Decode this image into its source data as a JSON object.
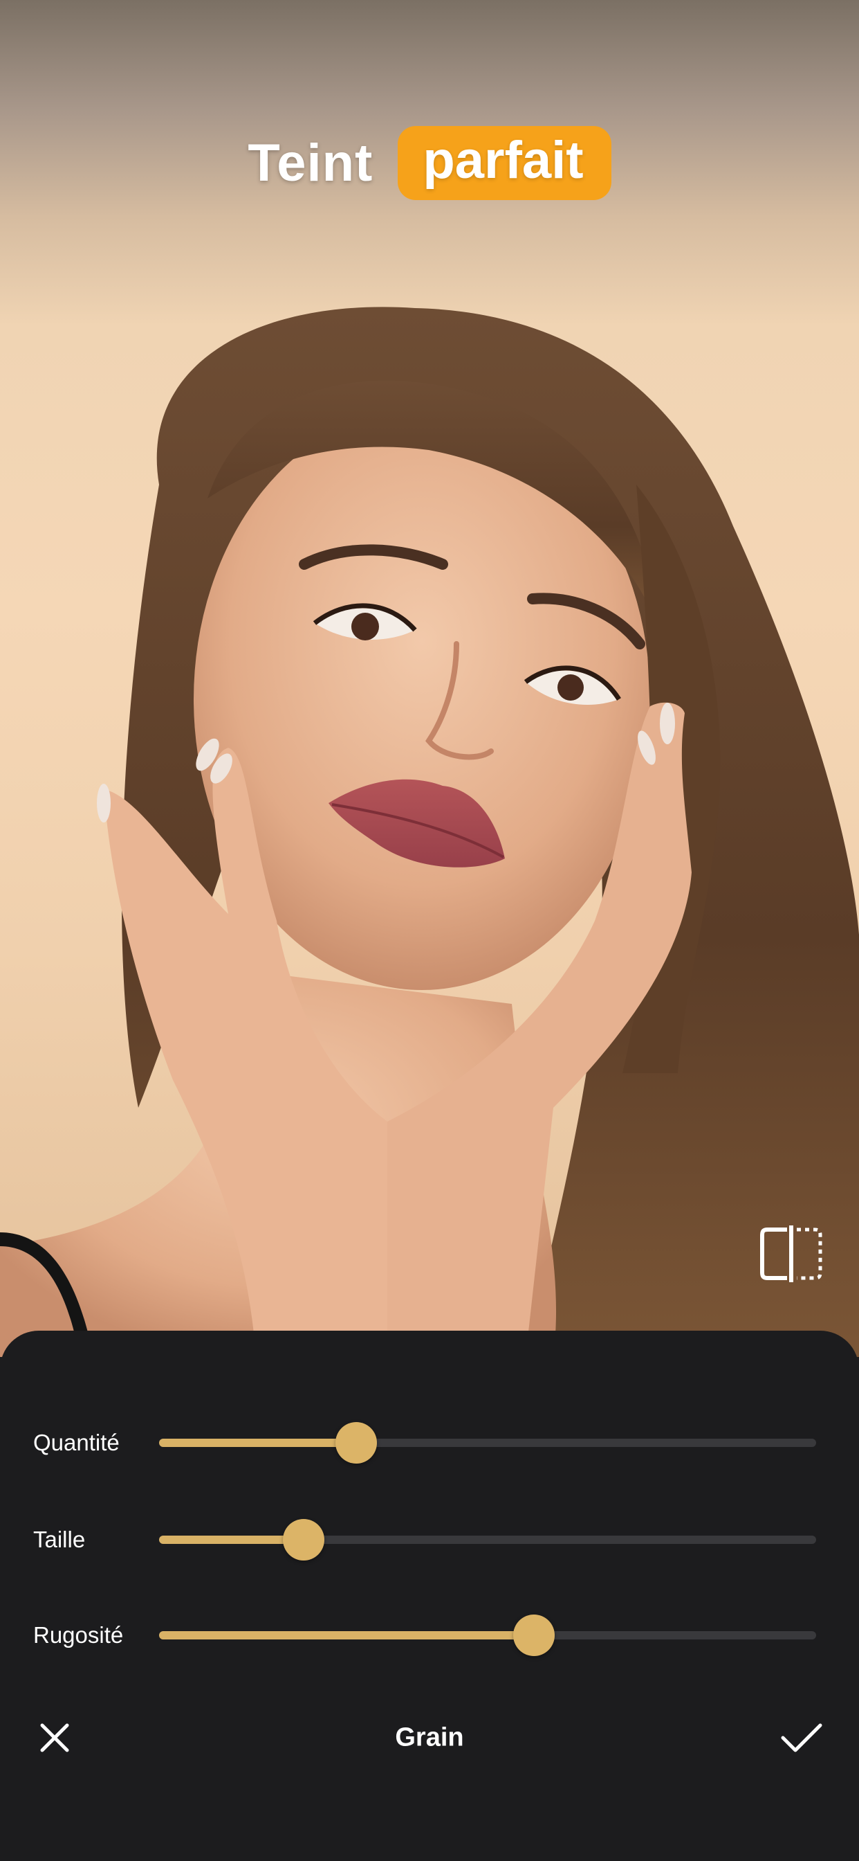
{
  "header": {
    "title_word": "Teint",
    "title_highlight": "parfait",
    "highlight_color": "#f6a21a"
  },
  "photo": {
    "subject": "portrait-photo"
  },
  "compare": {
    "icon": "compare-split-icon"
  },
  "sliders": [
    {
      "label": "Quantité",
      "value": 0.3
    },
    {
      "label": "Taille",
      "value": 0.22
    },
    {
      "label": "Rugosité",
      "value": 0.57
    }
  ],
  "footer": {
    "title": "Grain",
    "cancel_icon": "close-icon",
    "confirm_icon": "checkmark-icon"
  },
  "colors": {
    "accent": "#d9b266",
    "panel": "#1c1c1e",
    "track": "#39393c"
  }
}
